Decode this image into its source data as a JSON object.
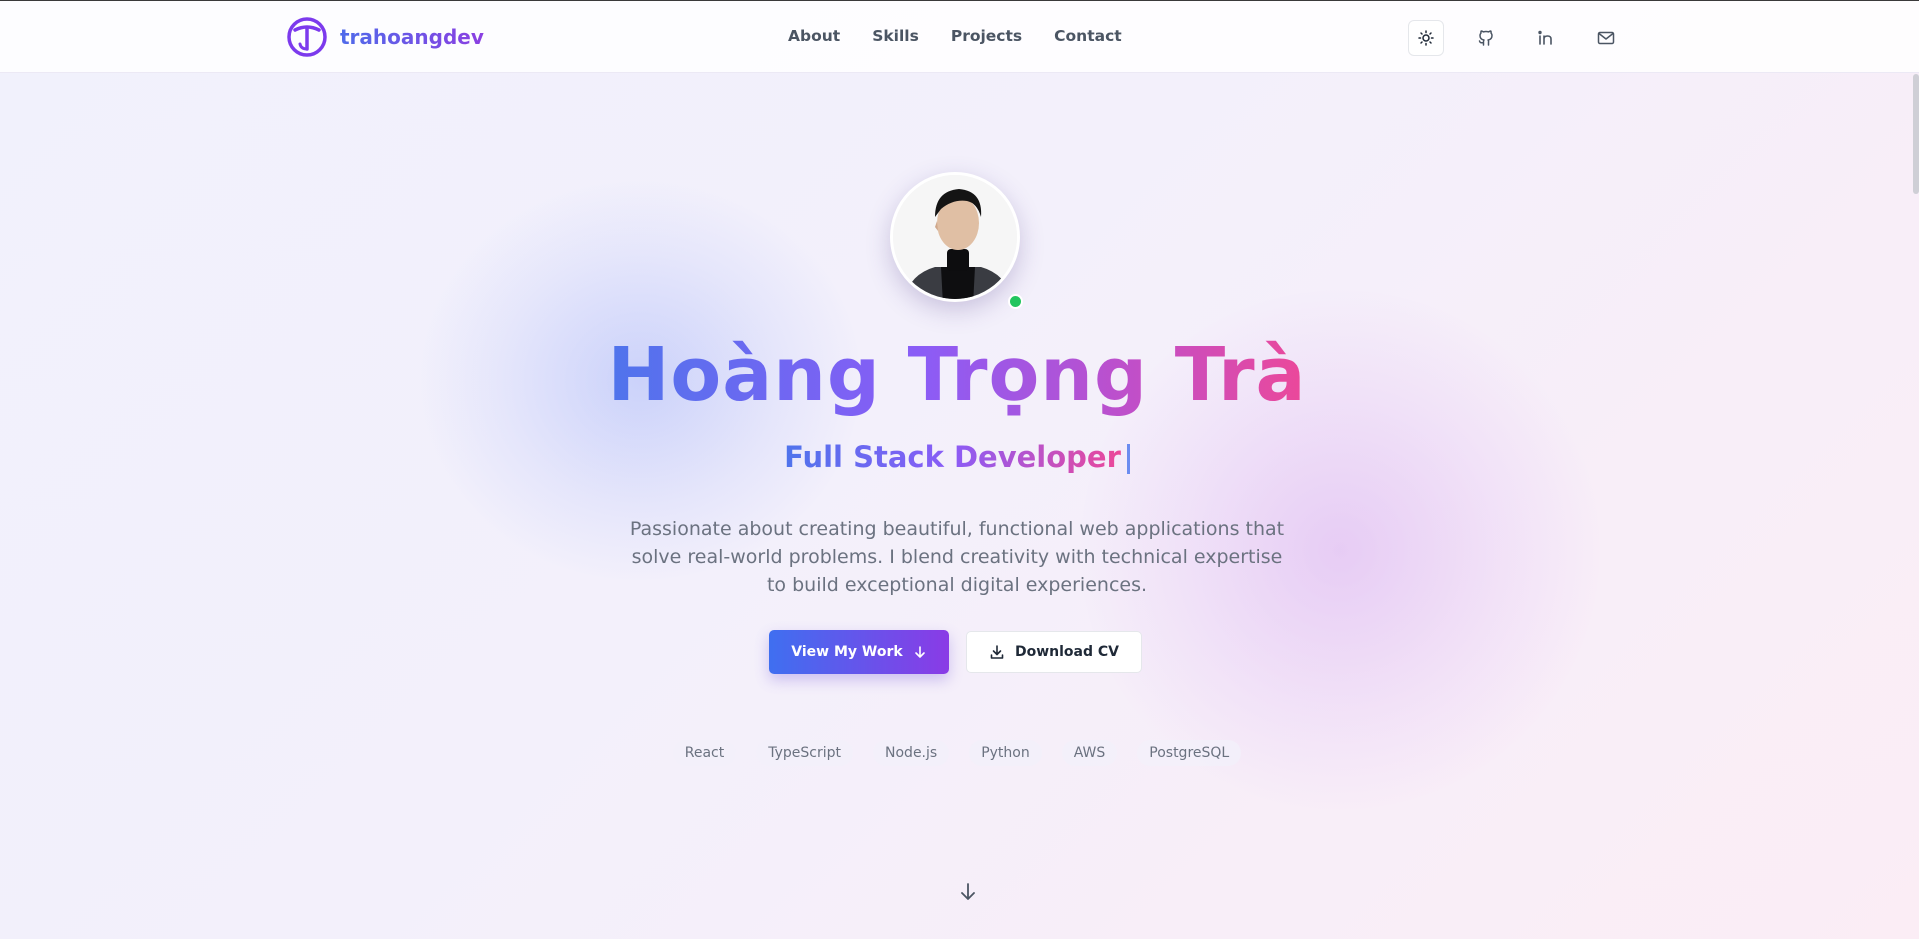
{
  "header": {
    "brand": "trahoangdev",
    "nav": [
      "About",
      "Skills",
      "Projects",
      "Contact"
    ],
    "icons": [
      "sun-icon",
      "github-icon",
      "linkedin-icon",
      "mail-icon"
    ]
  },
  "hero": {
    "name": "Hoàng Trọng Trà",
    "role": "Full Stack Developer",
    "description": "Passionate about creating beautiful, functional web applications that solve real-world problems. I blend creativity with technical expertise to build exceptional digital experiences.",
    "primary_button": "View My Work",
    "secondary_button": "Download CV",
    "tags": [
      "React",
      "TypeScript",
      "Node.js",
      "Python",
      "AWS",
      "PostgreSQL"
    ]
  },
  "colors": {
    "accent_blue": "#4f74ec",
    "accent_purple": "#8b5cf6",
    "accent_pink": "#ec4899",
    "online": "#22c55e"
  }
}
